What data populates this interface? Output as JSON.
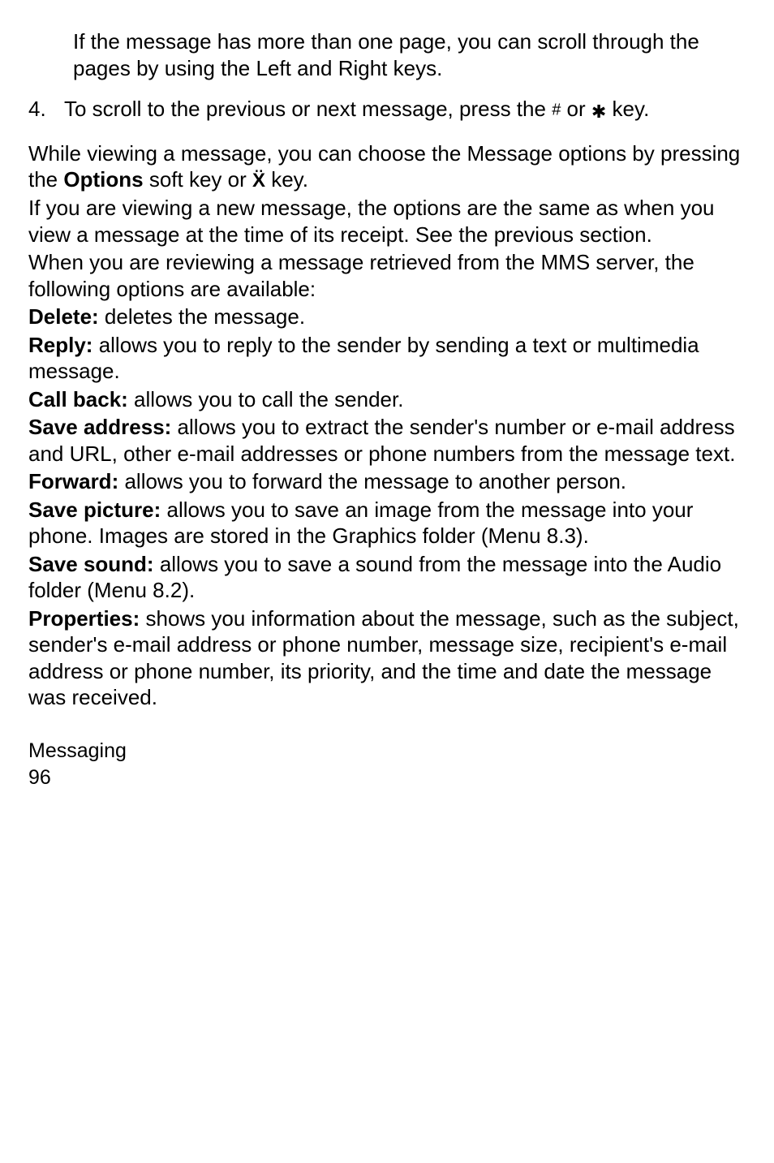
{
  "intro_indent": "If the message has more than one page, you can scroll through the pages by using the Left and Right keys.",
  "list": {
    "num": "4.",
    "text_a": "To scroll to the previous or next message, press the ",
    "hash": "#",
    "text_b": " or ",
    "star": "✱",
    "text_c": " key."
  },
  "p1_a": "While viewing a message, you can choose the Message options by pressing the ",
  "p1_bold": "Options",
  "p1_b": " soft key or ",
  "p1_xglyph": "Ẍ",
  "p1_c": " key.",
  "p2": "If you are viewing a new message, the options are the same as when you view a message at the time of its receipt. See the previous section.",
  "p3": "When you are reviewing a message retrieved from the MMS server, the following options are available:",
  "opts": {
    "delete_label": "Delete:",
    "delete_text": " deletes the message.",
    "reply_label": "Reply:",
    "reply_text": " allows you to reply to the sender by sending a text or multimedia message.",
    "callback_label": "Call back:",
    "callback_text": " allows you to call the sender.",
    "saveaddr_label": "Save address:",
    "saveaddr_text": " allows you to extract the sender's number or e-mail address and URL, other e-mail addresses or phone numbers from the message text.",
    "forward_label": "Forward:",
    "forward_text": " allows you to forward the message to another person.",
    "savepic_label": "Save picture:",
    "savepic_text": " allows you to save an image from the message into your phone. Images are stored in the Graphics folder (Menu 8.3).",
    "savesound_label": "Save sound:",
    "savesound_text": " allows you to save a sound from the message into the Audio folder (Menu 8.2).",
    "props_label": "Properties:",
    "props_text": " shows you information about the message, such as the subject, sender's e-mail address or phone number, message size, recipient's e-mail address or phone number, its priority, and the time and date the message was received."
  },
  "footer_title": "Messaging",
  "page_num": " 96"
}
